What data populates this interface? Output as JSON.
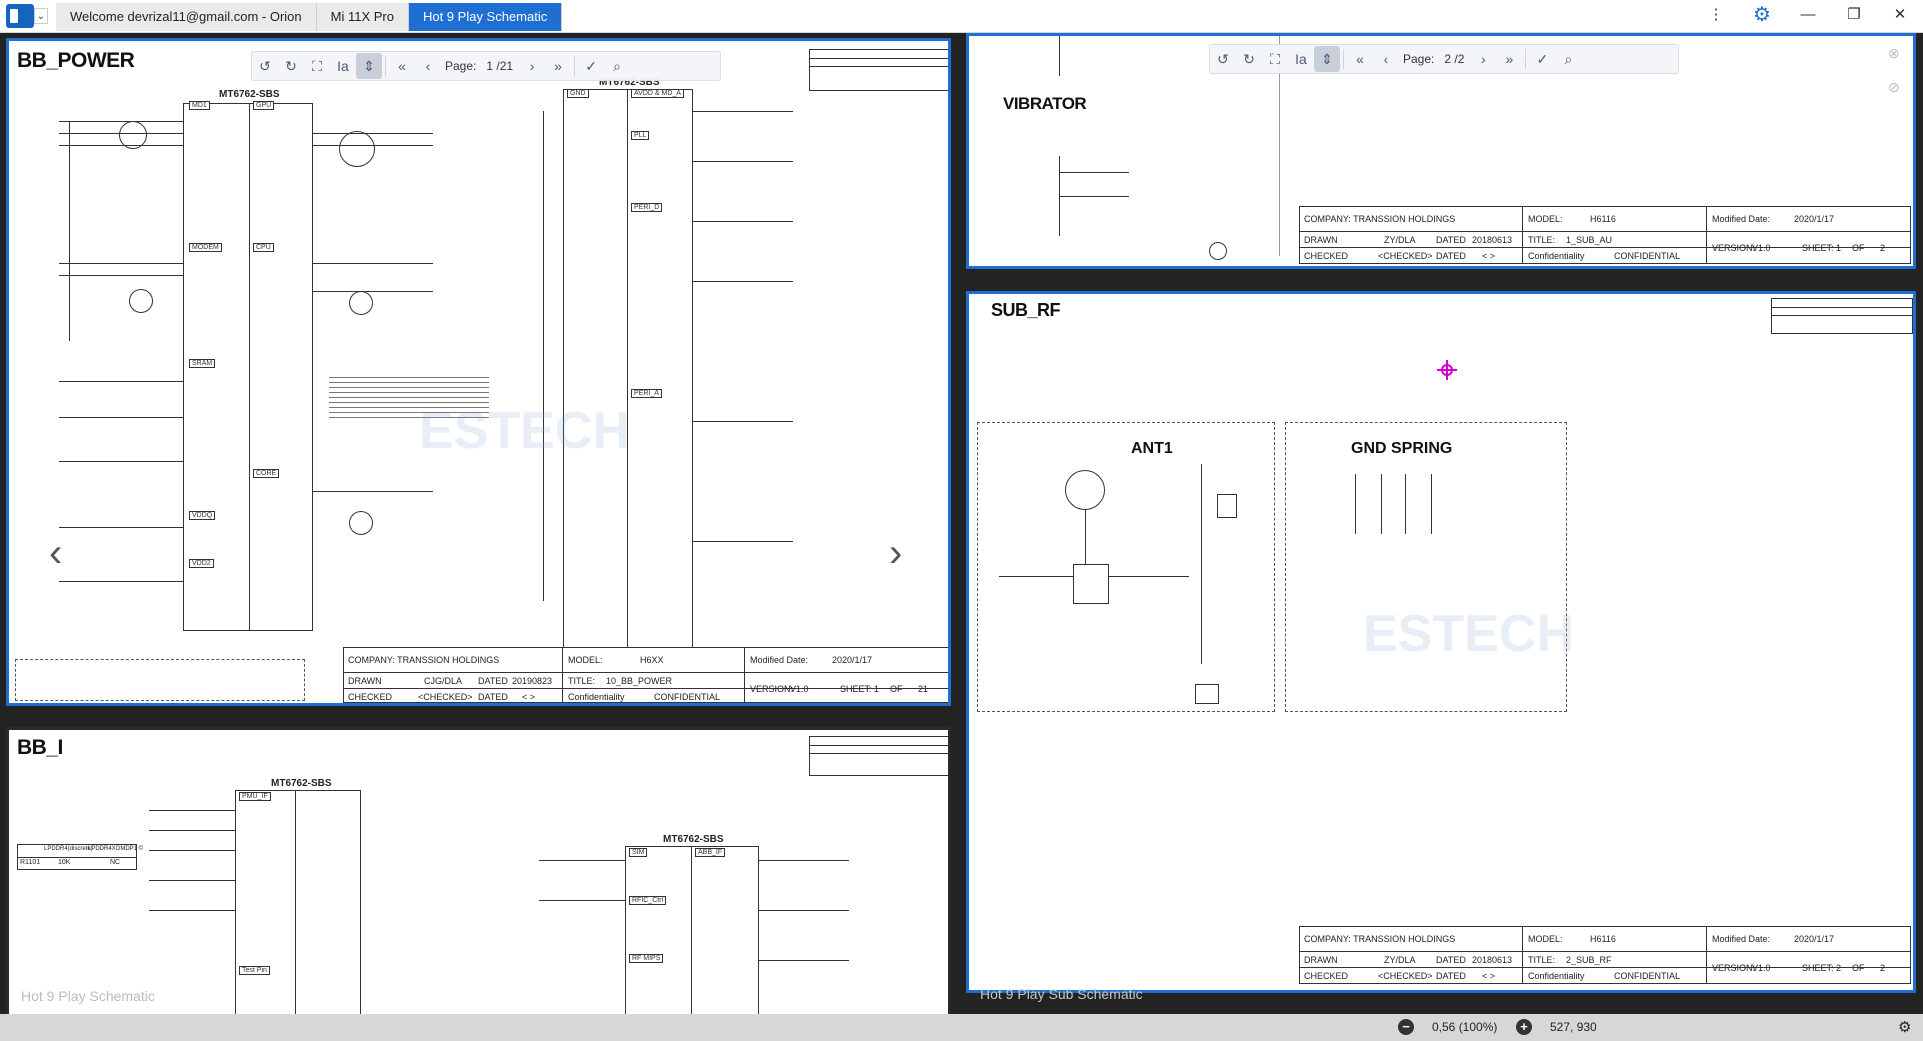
{
  "window": {
    "tabs": [
      {
        "label": "Welcome devrizal11@gmail.com - Orion"
      },
      {
        "label": "Mi 11X Pro"
      },
      {
        "label": "Hot 9 Play Schematic"
      }
    ],
    "controls": {
      "more": "⋮",
      "settings": "⚙",
      "minimize": "—",
      "restore": "❐",
      "close": "✕"
    }
  },
  "left_pane": {
    "footer": "Hot 9 Play Schematic",
    "toolbar": {
      "page_label": "Page:",
      "page_value": "1 /21"
    },
    "bb_power": {
      "title": "BB_POWER",
      "chip1": "MT6762-SBS",
      "chip2": "MT6762-SBS",
      "blocks": [
        "MD1",
        "GPU",
        "MODEM",
        "CPU",
        "SRAM",
        "CORE",
        "VDDQ",
        "VDD2"
      ],
      "blocks_right": [
        "GND",
        "AVDD & MD_A",
        "PLL",
        "PERI_D",
        "PERI_A"
      ],
      "titleblock": {
        "company": "COMPANY: TRANSSION HOLDINGS",
        "model_label": "MODEL:",
        "model": "H6XX",
        "modified_label": "Modified Date:",
        "modified": "2020/1/17",
        "drawn_label": "DRAWN",
        "drawn": "CJG/DLA",
        "dated_label": "DATED",
        "dated": "20190823",
        "title_label": "TITLE:",
        "title": "10_BB_POWER",
        "checked_label": "CHECKED",
        "checked": "<CHECKED>",
        "dated2_label": "DATED",
        "dated2": "< >",
        "conf_label": "Confidentiality",
        "conf": "CONFIDENTIAL",
        "version_label": "VERSION:",
        "version": "V1.0",
        "sheet_label": "SHEET:",
        "sheet": "1",
        "of_label": "OF",
        "of": "21"
      }
    },
    "bb_i": {
      "title": "BB_I",
      "chip1": "MT6762-SBS",
      "chip2": "MT6762-SBS",
      "blocks": [
        "PMU_IF",
        "SIM",
        "RFIC_Ctrl",
        "RF MIPS",
        "Test Pin",
        "ABB_IF"
      ],
      "r_table": {
        "name": "R1101",
        "h1": "LPDDR4(discrete)",
        "h2": "LPDDR4X",
        "h3": "DMDP1 ©",
        "v1": "10K",
        "v2": "NC"
      }
    }
  },
  "right_pane": {
    "footer": "Hot 9 Play Sub Schematic",
    "toolbar": {
      "page_label": "Page:",
      "page_value": "2 /2"
    },
    "vibrator": {
      "title": "VIBRATOR",
      "titleblock": {
        "company": "COMPANY: TRANSSION HOLDINGS",
        "model_label": "MODEL:",
        "model": "H6116",
        "modified_label": "Modified Date:",
        "modified": "2020/1/17",
        "drawn_label": "DRAWN",
        "drawn": "ZY/DLA",
        "dated_label": "DATED",
        "dated": "20180613",
        "title_label": "TITLE:",
        "title": "1_SUB_AU",
        "checked_label": "CHECKED",
        "checked": "<CHECKED>",
        "dated2_label": "DATED",
        "dated2": "< >",
        "conf_label": "Confidentiality",
        "conf": "CONFIDENTIAL",
        "version_label": "VERSION:",
        "version": "V1.0",
        "sheet_label": "SHEET:",
        "sheet": "1",
        "of_label": "OF",
        "of": "2"
      }
    },
    "sub_rf": {
      "title": "SUB_RF",
      "ant_label": "ANT1",
      "gnd_label": "GND SPRING",
      "titleblock": {
        "company": "COMPANY: TRANSSION HOLDINGS",
        "model_label": "MODEL:",
        "model": "H6116",
        "modified_label": "Modified Date:",
        "modified": "2020/1/17",
        "drawn_label": "DRAWN",
        "drawn": "ZY/DLA",
        "dated_label": "DATED",
        "dated": "20180613",
        "title_label": "TITLE:",
        "title": "2_SUB_RF",
        "checked_label": "CHECKED",
        "checked": "<CHECKED>",
        "dated2_label": "DATED",
        "dated2": "< >",
        "conf_label": "Confidentiality",
        "conf": "CONFIDENTIAL",
        "version_label": "VERSION:",
        "version": "V1.0",
        "sheet_label": "SHEET:",
        "sheet": "2",
        "of_label": "OF",
        "of": "2"
      }
    }
  },
  "status": {
    "zoom": "0,56 (100%)",
    "coords": "527, 930"
  },
  "colors": {
    "accent": "#1e6fd1",
    "marker": "#d000d0"
  }
}
